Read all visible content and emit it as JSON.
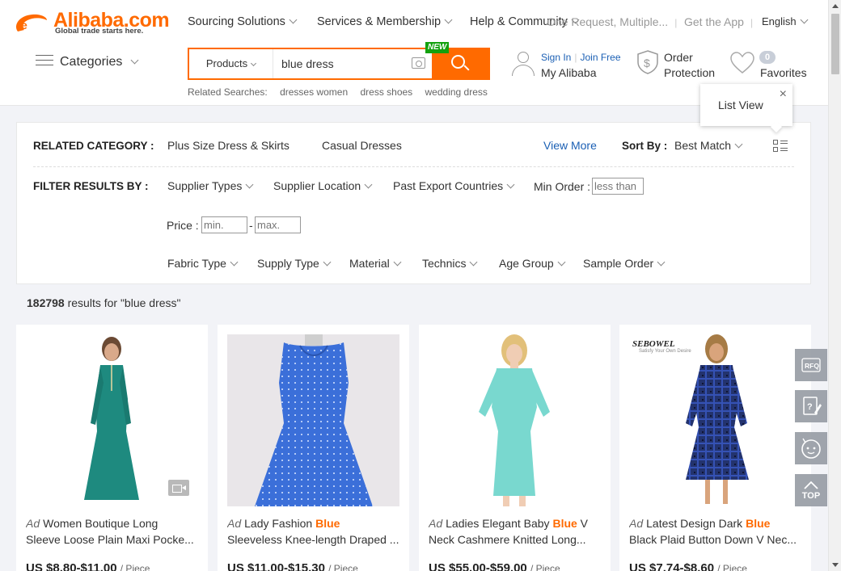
{
  "brand": {
    "name": "Alibaba.com",
    "tagline": "Global trade starts here.",
    "accent": "#ff6a00",
    "link_color": "#1a5fb4"
  },
  "top_nav": {
    "sourcing": "Sourcing Solutions",
    "services": "Services & Membership",
    "help": "Help & Community",
    "rfq_ghost": "One Request, Multiple...",
    "get_app": "Get the App",
    "language": "English"
  },
  "categories_label": "Categories",
  "search": {
    "scope": "Products",
    "query": "blue dress",
    "new_badge": "NEW"
  },
  "related_searches": {
    "label": "Related Searches:",
    "items": [
      "dresses women",
      "dress shoes",
      "wedding dress"
    ]
  },
  "account": {
    "sign_in": "Sign In",
    "join": "Join Free",
    "my_alibaba": "My Alibaba"
  },
  "order_protection": {
    "line1": "Order",
    "line2": "Protection"
  },
  "favorites": {
    "count": "0",
    "label": "Favorites"
  },
  "list_view_popup": {
    "label": "List View",
    "close": "×"
  },
  "filters": {
    "related_category_label": "RELATED CATEGORY :",
    "related_categories": [
      "Plus Size Dress & Skirts",
      "Casual Dresses"
    ],
    "view_more": "View More",
    "sort_by_label": "Sort By :",
    "sort_by_value": "Best Match",
    "filter_label": "FILTER RESULTS BY :",
    "row1": [
      "Supplier Types",
      "Supplier Location",
      "Past Export Countries"
    ],
    "min_order_label": "Min Order :",
    "min_order_placeholder": "less than",
    "price_label": "Price :",
    "price_min_placeholder": "min.",
    "price_dash": "-",
    "price_max_placeholder": "max.",
    "row3": [
      "Fabric Type",
      "Supply Type",
      "Material",
      "Technics",
      "Age Group",
      "Sample Order"
    ]
  },
  "results": {
    "count": "182798",
    "text": " results for \"blue dress\""
  },
  "products": [
    {
      "ad": "Ad",
      "title_pre": "Women Boutique Long",
      "keyword": "",
      "title_post": "",
      "line2": "Sleeve Loose Plain Maxi Pocke...",
      "price": "US $8.80-$11.00",
      "unit": "/ Piece"
    },
    {
      "ad": "Ad",
      "title_pre": "Lady Fashion ",
      "keyword": "Blue",
      "title_post": "",
      "line2": "Sleeveless Knee-length Draped ...",
      "price": "US $11.00-$15.30",
      "unit": "/ Piece"
    },
    {
      "ad": "Ad",
      "title_pre": "Ladies Elegant Baby ",
      "keyword": "Blue",
      "title_post": " V",
      "line2": "Neck Cashmere Knitted Long...",
      "price": "US $55.00-$59.00",
      "unit": "/ Piece"
    },
    {
      "ad": "Ad",
      "title_pre": "Latest Design Dark ",
      "keyword": "Blue",
      "title_post": "",
      "line2": "Black Plaid Button Down V Nec...",
      "price": "US $7.74-$8.60",
      "unit": "/ Piece"
    }
  ],
  "card4_brand": {
    "name": "SEBOWEL",
    "sub": "Satisfy Your Own Desire"
  },
  "side_toolbar": {
    "rfq": "RFQ",
    "top": "TOP"
  },
  "icons": [
    "logo-icon",
    "chevron-down-icon",
    "menu-icon",
    "camera-icon",
    "search-icon",
    "user-icon",
    "shield-dollar-icon",
    "heart-icon",
    "close-icon",
    "list-view-icon",
    "video-icon",
    "rfq-icon",
    "feedback-icon",
    "chat-icon",
    "arrow-up-icon"
  ]
}
